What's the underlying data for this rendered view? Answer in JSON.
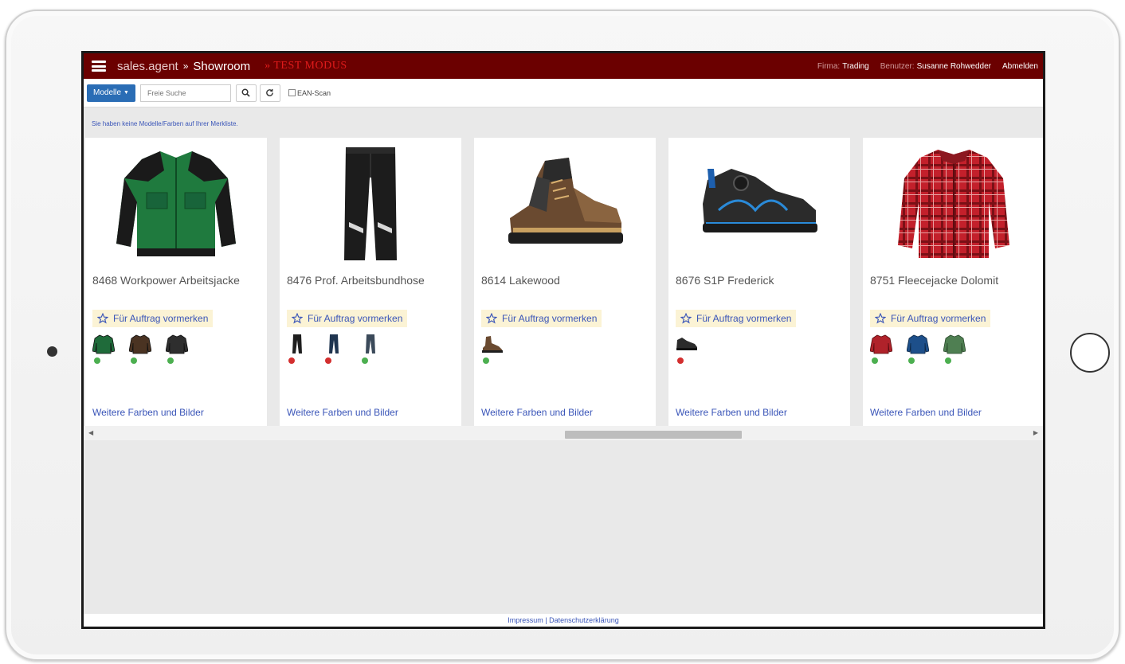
{
  "header": {
    "brand": "sales.agent",
    "breadcrumb_sep": "»",
    "breadcrumb_current": "Showroom",
    "test_mode": "» TEST MODUS",
    "firm_label": "Firma:",
    "firm_value": "Trading",
    "user_label": "Benutzer:",
    "user_value": "Susanne Rohwedder",
    "logout": "Abmelden"
  },
  "toolbar": {
    "modelle_label": "Modelle",
    "search_placeholder": "Freie Suche",
    "ean_label": "EAN-Scan"
  },
  "notice": "Sie haben keine Modelle/Farben auf Ihrer Merkliste.",
  "fav_label": "Für Auftrag vormerken",
  "more_label": "Weitere Farben und Bilder",
  "colors": {
    "header_bg": "#6b0000",
    "accent_blue": "#2a6db5",
    "link": "#3a55b8",
    "avail_green": "#4caf50",
    "avail_red": "#d32f2f"
  },
  "products": [
    {
      "title": "8468 Workpower Arbeitsjacke",
      "image": "green-jacket-icon",
      "variants": [
        {
          "color": "#1f6b3a",
          "status": "#4caf50"
        },
        {
          "color": "#4a3322",
          "status": "#4caf50"
        },
        {
          "color": "#2e2e2e",
          "status": "#4caf50"
        }
      ]
    },
    {
      "title": "8476 Prof. Arbeitsbundhose",
      "image": "black-trousers-icon",
      "variants": [
        {
          "color": "#1e1e1e",
          "status": "#d32f2f"
        },
        {
          "color": "#1f3550",
          "status": "#d32f2f"
        },
        {
          "color": "#3b4a5a",
          "status": "#4caf50"
        }
      ]
    },
    {
      "title": "8614 Lakewood",
      "image": "brown-boot-icon",
      "variants": [
        {
          "color": "#6a4a30",
          "status": "#4caf50"
        }
      ]
    },
    {
      "title": "8676 S1P Frederick",
      "image": "black-shoe-icon",
      "variants": [
        {
          "color": "#2b2b2b",
          "status": "#d32f2f"
        }
      ]
    },
    {
      "title": "8751 Fleecejacke Dolomit",
      "image": "red-plaid-jacket-icon",
      "variants": [
        {
          "color": "#b0222a",
          "status": "#4caf50"
        },
        {
          "color": "#1d4f8a",
          "status": "#4caf50"
        },
        {
          "color": "#4f7f52",
          "status": "#4caf50"
        }
      ]
    }
  ],
  "footer": {
    "impressum": "Impressum",
    "sep": "|",
    "privacy": "Datenschutzerklärung"
  }
}
